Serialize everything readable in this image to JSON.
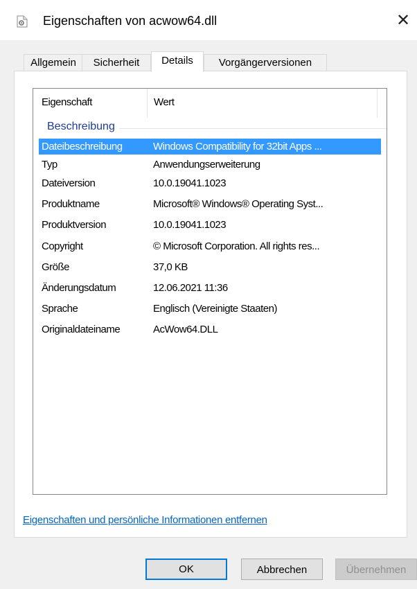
{
  "window": {
    "title": "Eigenschaften von acwow64.dll",
    "file_icon": "dll-file-icon",
    "close_glyph": "✕"
  },
  "tabs": [
    {
      "label": "Allgemein",
      "active": false
    },
    {
      "label": "Sicherheit",
      "active": false
    },
    {
      "label": "Details",
      "active": true
    },
    {
      "label": "Vorgängerversionen",
      "active": false
    }
  ],
  "details": {
    "columns": [
      "Eigenschaft",
      "Wert"
    ],
    "group": "Beschreibung",
    "rows": [
      {
        "property": "Dateibeschreibung",
        "value": "Windows Compatibility for 32bit Apps ...",
        "selected": true
      },
      {
        "property": "Typ",
        "value": "Anwendungserweiterung"
      },
      {
        "property": "Dateiversion",
        "value": "10.0.19041.1023"
      },
      {
        "property": "Produktname",
        "value": "Microsoft® Windows® Operating Syst..."
      },
      {
        "property": "Produktversion",
        "value": "10.0.19041.1023"
      },
      {
        "property": "Copyright",
        "value": "© Microsoft Corporation. All rights res..."
      },
      {
        "property": "Größe",
        "value": "37,0 KB"
      },
      {
        "property": "Änderungsdatum",
        "value": "12.06.2021 11:36"
      },
      {
        "property": "Sprache",
        "value": "Englisch (Vereinigte Staaten)"
      },
      {
        "property": "Originaldateiname",
        "value": "AcWow64.DLL"
      }
    ]
  },
  "remove_link": "Eigenschaften und persönliche Informationen entfernen",
  "buttons": {
    "ok": "OK",
    "cancel": "Abbrechen",
    "apply": "Übernehmen"
  },
  "colors": {
    "selection": "#3399ff",
    "link": "#0066cc",
    "group_header": "#1e3c96",
    "default_button_border": "#0078d7"
  }
}
